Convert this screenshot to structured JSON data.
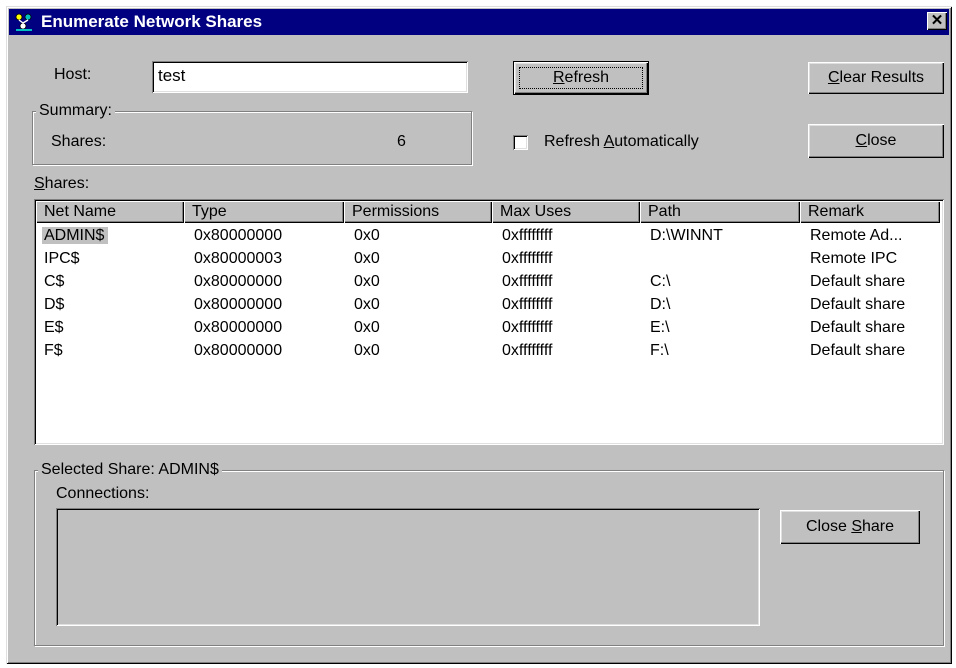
{
  "window": {
    "title": "Enumerate Network Shares",
    "close_glyph": "✕",
    "icon": "network-shares-icon"
  },
  "host": {
    "label": "Host:",
    "value": "test"
  },
  "buttons": {
    "refresh_pre": "",
    "refresh_mn": "R",
    "refresh_post": "efresh",
    "clear_pre": "C",
    "clear_post": "lear Results",
    "close_mn": "C",
    "close_post": "lose",
    "close_share_pre": "Close ",
    "close_share_mn": "S",
    "close_share_post": "hare"
  },
  "summary": {
    "group_label": "Summary:",
    "shares_label": "Shares:",
    "shares_count": "6"
  },
  "refresh_auto": {
    "pre": "Refresh ",
    "mn": "A",
    "post": "utomatically",
    "checked": false
  },
  "shares_section": {
    "label_mn": "S",
    "label_post": "hares:"
  },
  "table": {
    "columns": [
      "Net Name",
      "Type",
      "Permissions",
      "Max Uses",
      "Path",
      "Remark"
    ],
    "rows": [
      [
        "ADMIN$",
        "0x80000000",
        "0x0",
        "0xffffffff",
        "D:\\WINNT",
        "Remote Ad..."
      ],
      [
        "IPC$",
        "0x80000003",
        "0x0",
        "0xffffffff",
        "",
        "Remote IPC"
      ],
      [
        "C$",
        "0x80000000",
        "0x0",
        "0xffffffff",
        "C:\\",
        "Default share"
      ],
      [
        "D$",
        "0x80000000",
        "0x0",
        "0xffffffff",
        "D:\\",
        "Default share"
      ],
      [
        "E$",
        "0x80000000",
        "0x0",
        "0xffffffff",
        "E:\\",
        "Default share"
      ],
      [
        "F$",
        "0x80000000",
        "0x0",
        "0xffffffff",
        "F:\\",
        "Default share"
      ]
    ],
    "selected_row": 0
  },
  "selected_share": {
    "group_label": "Selected Share: ADMIN$",
    "connections_label": "Connections:"
  },
  "colors": {
    "title_bar": "#000080",
    "face": "#c0c0c0"
  }
}
